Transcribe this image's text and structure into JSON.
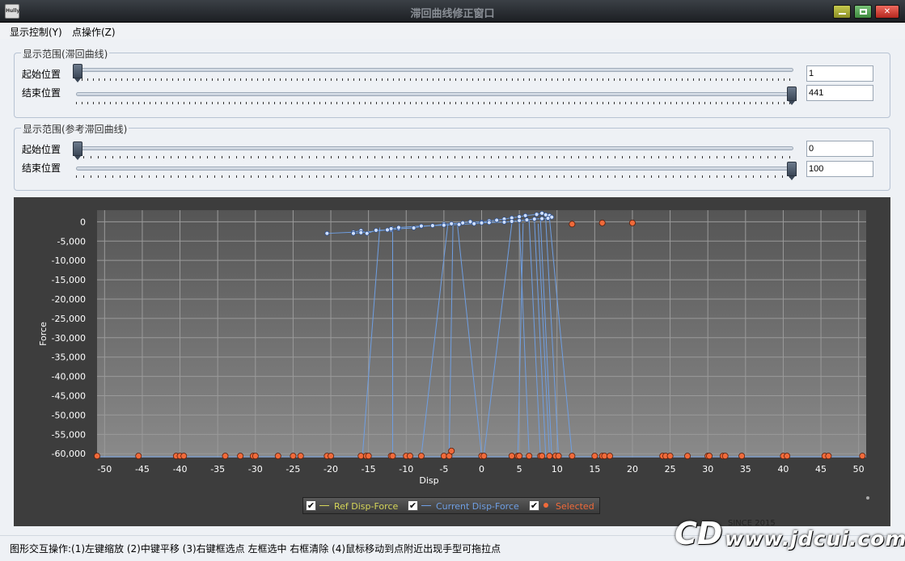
{
  "window": {
    "title": "滞回曲线修正窗口",
    "icon_label": "Hully",
    "minimize_icon": "minimize-icon",
    "maximize_icon": "maximize-icon",
    "close_icon": "close-icon"
  },
  "menu": {
    "items": [
      {
        "label": "显示控制(Y)"
      },
      {
        "label": "点操作(Z)"
      }
    ]
  },
  "range1": {
    "title": "显示范围(滞回曲线)",
    "start_label": "起始位置",
    "end_label": "结束位置",
    "start_value": "1",
    "end_value": "441",
    "start_fraction": 0.0,
    "end_fraction": 1.0
  },
  "range2": {
    "title": "显示范围(参考滞回曲线)",
    "start_label": "起始位置",
    "end_label": "结束位置",
    "start_value": "0",
    "end_value": "100",
    "start_fraction": 0.0,
    "end_fraction": 1.0
  },
  "chart_data": {
    "type": "line",
    "xlabel": "Disp",
    "ylabel": "Force",
    "xlim": [
      -51,
      51
    ],
    "ylim": [
      -61000,
      3000
    ],
    "xticks": [
      -50,
      -45,
      -40,
      -35,
      -30,
      -25,
      -20,
      -15,
      -10,
      -5,
      0,
      5,
      10,
      15,
      20,
      25,
      30,
      35,
      40,
      45,
      50
    ],
    "yticks": [
      0,
      -5000,
      -10000,
      -15000,
      -20000,
      -25000,
      -30000,
      -35000,
      -40000,
      -45000,
      -50000,
      -55000,
      -60000
    ],
    "ytick_labels": [
      "0",
      "-5,000",
      "-10,000",
      "-15,000",
      "-20,000",
      "-25,000",
      "-30,000",
      "-35,000",
      "-40,000",
      "-45,000",
      "-50,000",
      "-55,000",
      "-60,000"
    ],
    "grid": true,
    "legend_position": "bottom-center",
    "colors": {
      "ref": "#d6d65a",
      "current": "#6f9fe3",
      "selected": "#f06a3a"
    },
    "series": [
      {
        "name": "Ref Disp-Force",
        "x": [],
        "y": []
      },
      {
        "name": "Current Disp-Force",
        "x": [
          -20.5,
          -17,
          -16,
          -15.2,
          -14,
          -12,
          -11,
          -9,
          -8,
          -6.5,
          -5,
          -4,
          -2.5,
          -1.5,
          0,
          1,
          2,
          3,
          4,
          5,
          5.8,
          7.3,
          8,
          8.5,
          9,
          9.3,
          8.8,
          8,
          7,
          6,
          5,
          4,
          3,
          1,
          0,
          -1,
          -3,
          -5,
          -8,
          -11,
          -12,
          -12.5,
          -16,
          -17
        ],
        "y": [
          -3000,
          -2700,
          -2300,
          -3000,
          -2200,
          -2100,
          -1800,
          -1600,
          -1200,
          -1000,
          -600,
          -500,
          -300,
          0,
          -100,
          200,
          400,
          700,
          1000,
          1300,
          1600,
          1900,
          2200,
          1800,
          1600,
          1200,
          900,
          800,
          700,
          500,
          300,
          100,
          -100,
          -200,
          -300,
          -500,
          -700,
          -900,
          -1100,
          -1500,
          -1800,
          -2100,
          -2800,
          -3000
        ]
      },
      {
        "name": "Selected",
        "x": [
          -51,
          -45.5,
          -40.5,
          -40,
          -39.5,
          -34,
          -32,
          -30.3,
          -30,
          -27,
          -25,
          -24,
          -20.5,
          -20,
          -16,
          -15.3,
          -15,
          -12,
          -11.8,
          -10,
          -9.5,
          -8,
          -5,
          -4.3,
          -4,
          0,
          0.3,
          4,
          4.8,
          5,
          6.3,
          7.8,
          8,
          9,
          9.8,
          10.2,
          12,
          15,
          16,
          16.3,
          17,
          24,
          24.4,
          25,
          27.3,
          30,
          30.2,
          32,
          32.3,
          34.5,
          40,
          40.5,
          45.5,
          46,
          50.5,
          12,
          16,
          20
        ],
        "y": [
          -60600,
          -60600,
          -60600,
          -60600,
          -60600,
          -60600,
          -60600,
          -60600,
          -60600,
          -60600,
          -60600,
          -60600,
          -60600,
          -60600,
          -60600,
          -60600,
          -60600,
          -60600,
          -60600,
          -60600,
          -60600,
          -60600,
          -60600,
          -60600,
          -59300,
          -60600,
          -60600,
          -60600,
          -60600,
          -60600,
          -60600,
          -60600,
          -60600,
          -60600,
          -60600,
          -60600,
          -60600,
          -60600,
          -60600,
          -60600,
          -60600,
          -60600,
          -60600,
          -60600,
          -60600,
          -60600,
          -60600,
          -60600,
          -60600,
          -60600,
          -60600,
          -60600,
          -60600,
          -60600,
          -60600,
          -600,
          -300,
          -300
        ]
      }
    ],
    "spikes": [
      {
        "from": [
          -13.5,
          -1500
        ],
        "to": [
          -15.8,
          -60600
        ]
      },
      {
        "from": [
          -11.8,
          -1200
        ],
        "to": [
          -11.8,
          -60600
        ]
      },
      {
        "from": [
          -4.5,
          -1000
        ],
        "to": [
          -8,
          -60600
        ]
      },
      {
        "from": [
          -3.8,
          -1000
        ],
        "to": [
          -4.3,
          -59300
        ]
      },
      {
        "from": [
          -3.2,
          -900
        ],
        "to": [
          0,
          -60600
        ]
      },
      {
        "from": [
          4,
          -500
        ],
        "to": [
          0.3,
          -60600
        ]
      },
      {
        "from": [
          5.5,
          -400
        ],
        "to": [
          4.8,
          -60600
        ]
      },
      {
        "from": [
          5,
          -300
        ],
        "to": [
          6.3,
          -60600
        ]
      },
      {
        "from": [
          6.3,
          400
        ],
        "to": [
          7.8,
          -60600
        ]
      },
      {
        "from": [
          7,
          500
        ],
        "to": [
          8.5,
          -60600
        ]
      },
      {
        "from": [
          7.8,
          600
        ],
        "to": [
          9.3,
          -60600
        ]
      },
      {
        "from": [
          8.5,
          700
        ],
        "to": [
          10.2,
          -60600
        ]
      },
      {
        "from": [
          9,
          900
        ],
        "to": [
          12,
          -60600
        ]
      },
      {
        "from": [
          7.5,
          -500
        ],
        "to": [
          9,
          -60600
        ]
      }
    ]
  },
  "legend": {
    "items": [
      {
        "label": "Ref Disp-Force",
        "checked": "✔"
      },
      {
        "label": "Current Disp-Force",
        "checked": "✔"
      },
      {
        "label": "Selected",
        "checked": "✔"
      }
    ]
  },
  "status": {
    "text": "图形交互操作:(1)左键缩放 (2)中键平移 (3)右键框选点 左框选中 右框清除 (4)鼠标移动到点附近出现手型可拖拉点"
  },
  "watermark": {
    "logo": "CD",
    "since": "SINCE 2015",
    "url": "www.jdcui.com"
  }
}
